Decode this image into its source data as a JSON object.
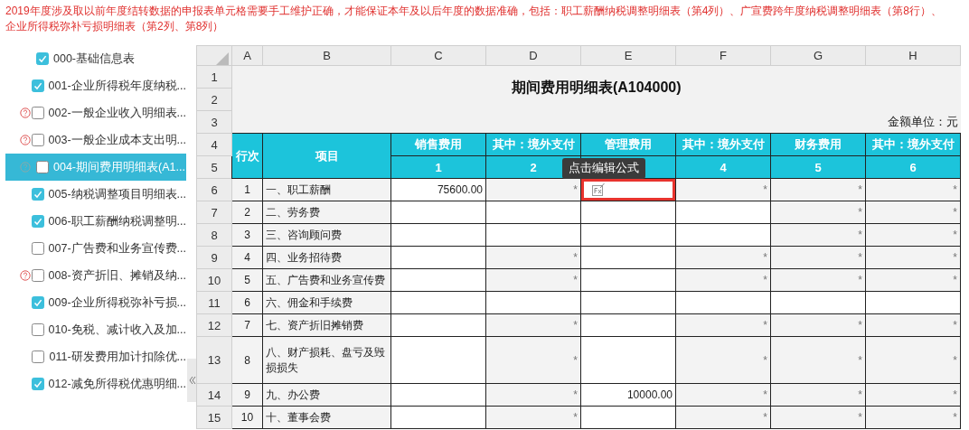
{
  "notice": "2019年度涉及取以前年度结转数据的申报表单元格需要手工维护正确，才能保证本年及以后年度的数据准确，包括：职工薪酬纳税调整明细表（第4列）、广宣费跨年度纳税调整明细表（第8行）、企业所得税弥补亏损明细表（第2列、第8列）",
  "sidebar": {
    "items": [
      {
        "label": "000-基础信息表",
        "checked": true,
        "warning": false,
        "selected": false
      },
      {
        "label": "001-企业所得税年度纳税...",
        "checked": true,
        "warning": false,
        "selected": false
      },
      {
        "label": "002-一般企业收入明细表...",
        "checked": false,
        "warning": true,
        "selected": false
      },
      {
        "label": "003-一般企业成本支出明...",
        "checked": false,
        "warning": true,
        "selected": false
      },
      {
        "label": "004-期间费用明细表(A1...",
        "checked": false,
        "warning": true,
        "selected": true
      },
      {
        "label": "005-纳税调整项目明细表...",
        "checked": true,
        "warning": false,
        "selected": false
      },
      {
        "label": "006-职工薪酬纳税调整明...",
        "checked": true,
        "warning": false,
        "selected": false
      },
      {
        "label": "007-广告费和业务宣传费...",
        "checked": false,
        "warning": false,
        "selected": false
      },
      {
        "label": "008-资产折旧、摊销及纳...",
        "checked": false,
        "warning": true,
        "selected": false
      },
      {
        "label": "009-企业所得税弥补亏损...",
        "checked": true,
        "warning": false,
        "selected": false
      },
      {
        "label": "010-免税、减计收入及加...",
        "checked": false,
        "warning": false,
        "selected": false
      },
      {
        "label": "011-研发费用加计扣除优...",
        "checked": false,
        "warning": false,
        "selected": false
      },
      {
        "label": "012-减免所得税优惠明细...",
        "checked": true,
        "warning": false,
        "selected": false
      }
    ]
  },
  "sheet": {
    "column_headers": [
      "A",
      "B",
      "C",
      "D",
      "E",
      "F",
      "G",
      "H"
    ],
    "row_headers": [
      "1",
      "2",
      "3",
      "4",
      "5",
      "6",
      "7",
      "8",
      "9",
      "10",
      "11",
      "12",
      "13",
      "14",
      "15"
    ],
    "title": "期间费用明细表(A104000)",
    "unit": "金额单位：元",
    "line_header": "行次",
    "item_header": "项目",
    "columns": [
      {
        "title": "销售费用",
        "number": "1"
      },
      {
        "title": "其中：境外支付",
        "number": "2"
      },
      {
        "title": "管理费用"
      },
      {
        "title": "其中：境外支付",
        "number": "4"
      },
      {
        "title": "财务费用",
        "number": "5"
      },
      {
        "title": "其中：境外支付",
        "number": "6"
      }
    ],
    "tooltip": "点击编辑公式",
    "rows": [
      {
        "line": "1",
        "item": "一、职工薪酬",
        "cells": [
          {
            "value": "75600.00",
            "locked": false,
            "selected": false
          },
          {
            "value": "*",
            "locked": true,
            "selected": false
          },
          {
            "locked": false,
            "selected": true
          },
          {
            "value": "*",
            "locked": true,
            "selected": false
          },
          {
            "value": "*",
            "locked": true,
            "selected": false
          },
          {
            "value": "*",
            "locked": true,
            "selected": false
          }
        ]
      },
      {
        "line": "2",
        "item": "二、劳务费",
        "cells": [
          {
            "locked": false,
            "selected": false
          },
          {
            "locked": false,
            "selected": false
          },
          {
            "locked": false,
            "selected": false
          },
          {
            "locked": false,
            "selected": false
          },
          {
            "value": "*",
            "locked": true,
            "selected": false
          },
          {
            "value": "*",
            "locked": true,
            "selected": false
          }
        ]
      },
      {
        "line": "3",
        "item": "三、咨询顾问费",
        "cells": [
          {
            "locked": false,
            "selected": false
          },
          {
            "locked": false,
            "selected": false
          },
          {
            "locked": false,
            "selected": false
          },
          {
            "locked": false,
            "selected": false
          },
          {
            "value": "*",
            "locked": true,
            "selected": false
          },
          {
            "value": "*",
            "locked": true,
            "selected": false
          }
        ]
      },
      {
        "line": "4",
        "item": "四、业务招待费",
        "cells": [
          {
            "locked": false,
            "selected": false
          },
          {
            "value": "*",
            "locked": true,
            "selected": false
          },
          {
            "locked": false,
            "selected": false
          },
          {
            "value": "*",
            "locked": true,
            "selected": false
          },
          {
            "value": "*",
            "locked": true,
            "selected": false
          },
          {
            "value": "*",
            "locked": true,
            "selected": false
          }
        ]
      },
      {
        "line": "5",
        "item": "五、广告费和业务宣传费",
        "cells": [
          {
            "locked": false,
            "selected": false
          },
          {
            "value": "*",
            "locked": true,
            "selected": false
          },
          {
            "locked": false,
            "selected": false
          },
          {
            "value": "*",
            "locked": true,
            "selected": false
          },
          {
            "value": "*",
            "locked": true,
            "selected": false
          },
          {
            "value": "*",
            "locked": true,
            "selected": false
          }
        ]
      },
      {
        "line": "6",
        "item": "六、佣金和手续费",
        "cells": [
          {
            "locked": false,
            "selected": false
          },
          {
            "locked": false,
            "selected": false
          },
          {
            "locked": false,
            "selected": false
          },
          {
            "locked": false,
            "selected": false
          },
          {
            "locked": false,
            "selected": false
          },
          {
            "locked": false,
            "selected": false
          }
        ]
      },
      {
        "line": "7",
        "item": "七、资产折旧摊销费",
        "cells": [
          {
            "locked": false,
            "selected": false
          },
          {
            "value": "*",
            "locked": true,
            "selected": false
          },
          {
            "locked": false,
            "selected": false
          },
          {
            "value": "*",
            "locked": true,
            "selected": false
          },
          {
            "value": "*",
            "locked": true,
            "selected": false
          },
          {
            "value": "*",
            "locked": true,
            "selected": false
          }
        ]
      },
      {
        "line": "8",
        "item": "八、财产损耗、盘亏及毁损损失",
        "cells": [
          {
            "locked": false,
            "selected": false
          },
          {
            "value": "*",
            "locked": true,
            "selected": false
          },
          {
            "locked": false,
            "selected": false
          },
          {
            "value": "*",
            "locked": true,
            "selected": false
          },
          {
            "value": "*",
            "locked": true,
            "selected": false
          },
          {
            "value": "*",
            "locked": true,
            "selected": false
          }
        ]
      },
      {
        "line": "9",
        "item": "九、办公费",
        "cells": [
          {
            "locked": false,
            "selected": false
          },
          {
            "value": "*",
            "locked": true,
            "selected": false
          },
          {
            "value": "10000.00",
            "locked": false,
            "selected": false
          },
          {
            "value": "*",
            "locked": true,
            "selected": false
          },
          {
            "value": "*",
            "locked": true,
            "selected": false
          },
          {
            "value": "*",
            "locked": true,
            "selected": false
          }
        ]
      },
      {
        "line": "10",
        "item": "十、董事会费",
        "cells": [
          {
            "locked": false,
            "selected": false
          },
          {
            "value": "*",
            "locked": true,
            "selected": false
          },
          {
            "locked": false,
            "selected": false
          },
          {
            "value": "*",
            "locked": true,
            "selected": false
          },
          {
            "value": "*",
            "locked": true,
            "selected": false
          },
          {
            "value": "*",
            "locked": true,
            "selected": false
          }
        ]
      }
    ]
  }
}
